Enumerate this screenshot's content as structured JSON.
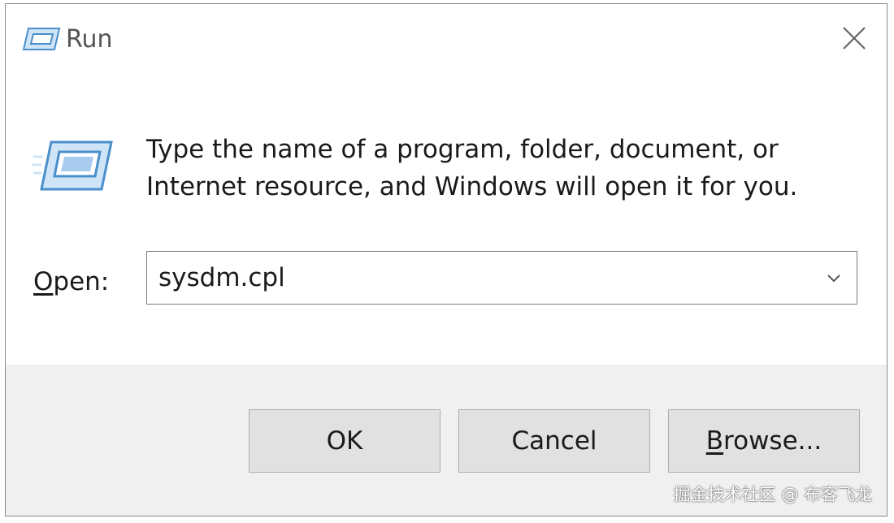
{
  "window": {
    "title": "Run",
    "title_icon": "run-icon",
    "close_icon": "close-icon"
  },
  "content": {
    "icon": "run-icon",
    "description_line1": "Type the name of a program, folder, document, or",
    "description_line2": "Internet resource, and Windows will open it for you.",
    "open_label_mnemonic": "O",
    "open_label_rest": "pen:",
    "open_value": "sysdm.cpl",
    "dropdown_icon": "chevron-down-icon"
  },
  "buttons": {
    "ok": "OK",
    "cancel": "Cancel",
    "browse_mnemonic": "B",
    "browse_rest": "rowse..."
  },
  "watermark": "掘金技术社区 @ 布客飞龙",
  "colors": {
    "footer_bg": "#f0f0f0",
    "button_bg": "#e1e1e1",
    "button_border": "#adadad",
    "icon_blue": "#5aa0d8"
  }
}
